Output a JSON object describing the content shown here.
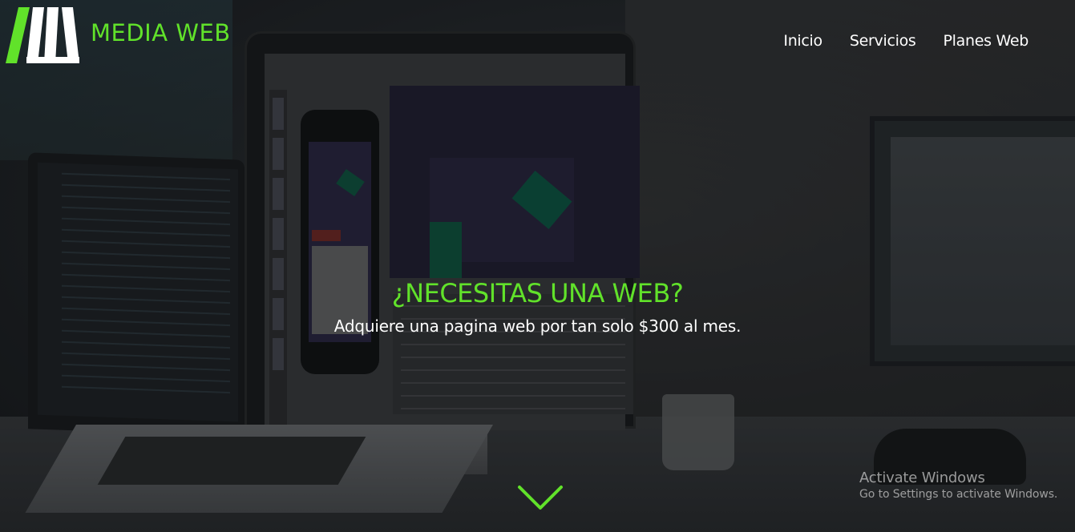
{
  "brand": {
    "name": "MEDIA WEB",
    "accent_color": "#61e22a"
  },
  "nav": {
    "items": [
      {
        "label": "Inicio"
      },
      {
        "label": "Servicios"
      },
      {
        "label": "Planes Web"
      }
    ]
  },
  "hero": {
    "headline": "¿NECESITAS UNA WEB?",
    "subheadline": "Adquiere una pagina web por tan solo $300 al mes.",
    "scroll_icon": "chevron-down-icon"
  },
  "watermark": {
    "title": "Activate Windows",
    "subtitle": "Go to Settings to activate Windows."
  }
}
